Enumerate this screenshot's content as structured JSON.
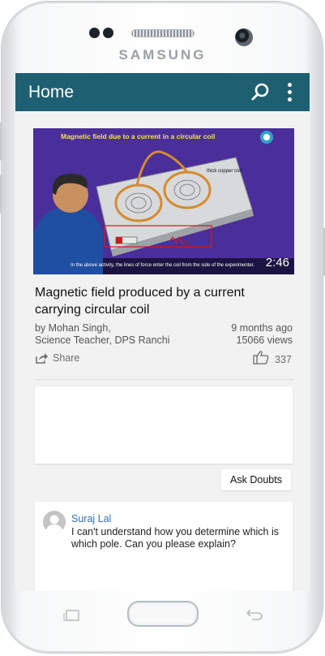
{
  "device": {
    "brand": "SAMSUNG"
  },
  "appbar": {
    "title": "Home",
    "search_icon": "search-icon",
    "menu_icon": "more-vert-icon"
  },
  "video": {
    "duration": "2:46",
    "thumbnail_caption": "Magnetic field due to a current in a circular coil",
    "thumbnail_label": "thick copper coil",
    "thumbnail_subtitle": "In the above activity, the lines of force enter the coil from the side of the experimenter."
  },
  "post": {
    "title": "Magnetic field produced by a current carrying circular coil",
    "author_line1": "by Mohan Singh,",
    "author_line2": "Science Teacher, DPS Ranchi",
    "time": "9 months ago",
    "views": "15066 views",
    "share_label": "Share",
    "likes": "337"
  },
  "ask_button": "Ask Doubts",
  "comment": {
    "author": "Suraj Lal",
    "text": "I can't understand how you determine which is which pole. Can you please explain?"
  },
  "colors": {
    "appbar": "#1e5f72",
    "author_link": "#2f6db5"
  }
}
